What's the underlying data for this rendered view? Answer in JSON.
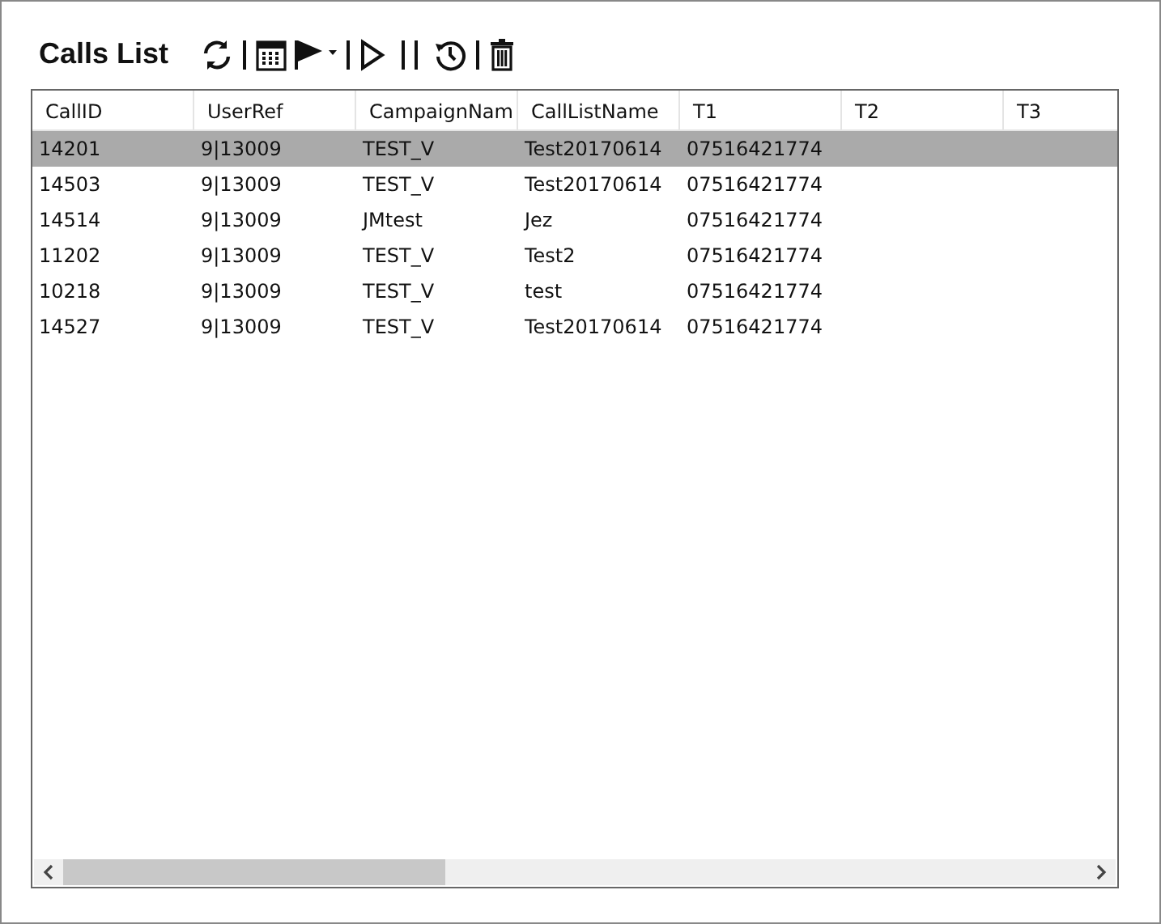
{
  "title": "Calls List",
  "table": {
    "columns": [
      "CallID",
      "UserRef",
      "CampaignNam",
      "CallListName",
      "T1",
      "T2",
      "T3"
    ],
    "rows": [
      {
        "cells": [
          "14201",
          "9|13009",
          "TEST_V",
          "Test20170614",
          "07516421774",
          "",
          ""
        ],
        "selected": true
      },
      {
        "cells": [
          "14503",
          "9|13009",
          "TEST_V",
          "Test20170614",
          "07516421774",
          "",
          ""
        ],
        "selected": false
      },
      {
        "cells": [
          "14514",
          "9|13009",
          "JMtest",
          "Jez",
          "07516421774",
          "",
          ""
        ],
        "selected": false
      },
      {
        "cells": [
          "11202",
          "9|13009",
          "TEST_V",
          "Test2",
          "07516421774",
          "",
          ""
        ],
        "selected": false
      },
      {
        "cells": [
          "10218",
          "9|13009",
          "TEST_V",
          "test",
          "07516421774",
          "",
          ""
        ],
        "selected": false
      },
      {
        "cells": [
          "14527",
          "9|13009",
          "TEST_V",
          "Test20170614",
          "07516421774",
          "",
          ""
        ],
        "selected": false
      }
    ]
  }
}
